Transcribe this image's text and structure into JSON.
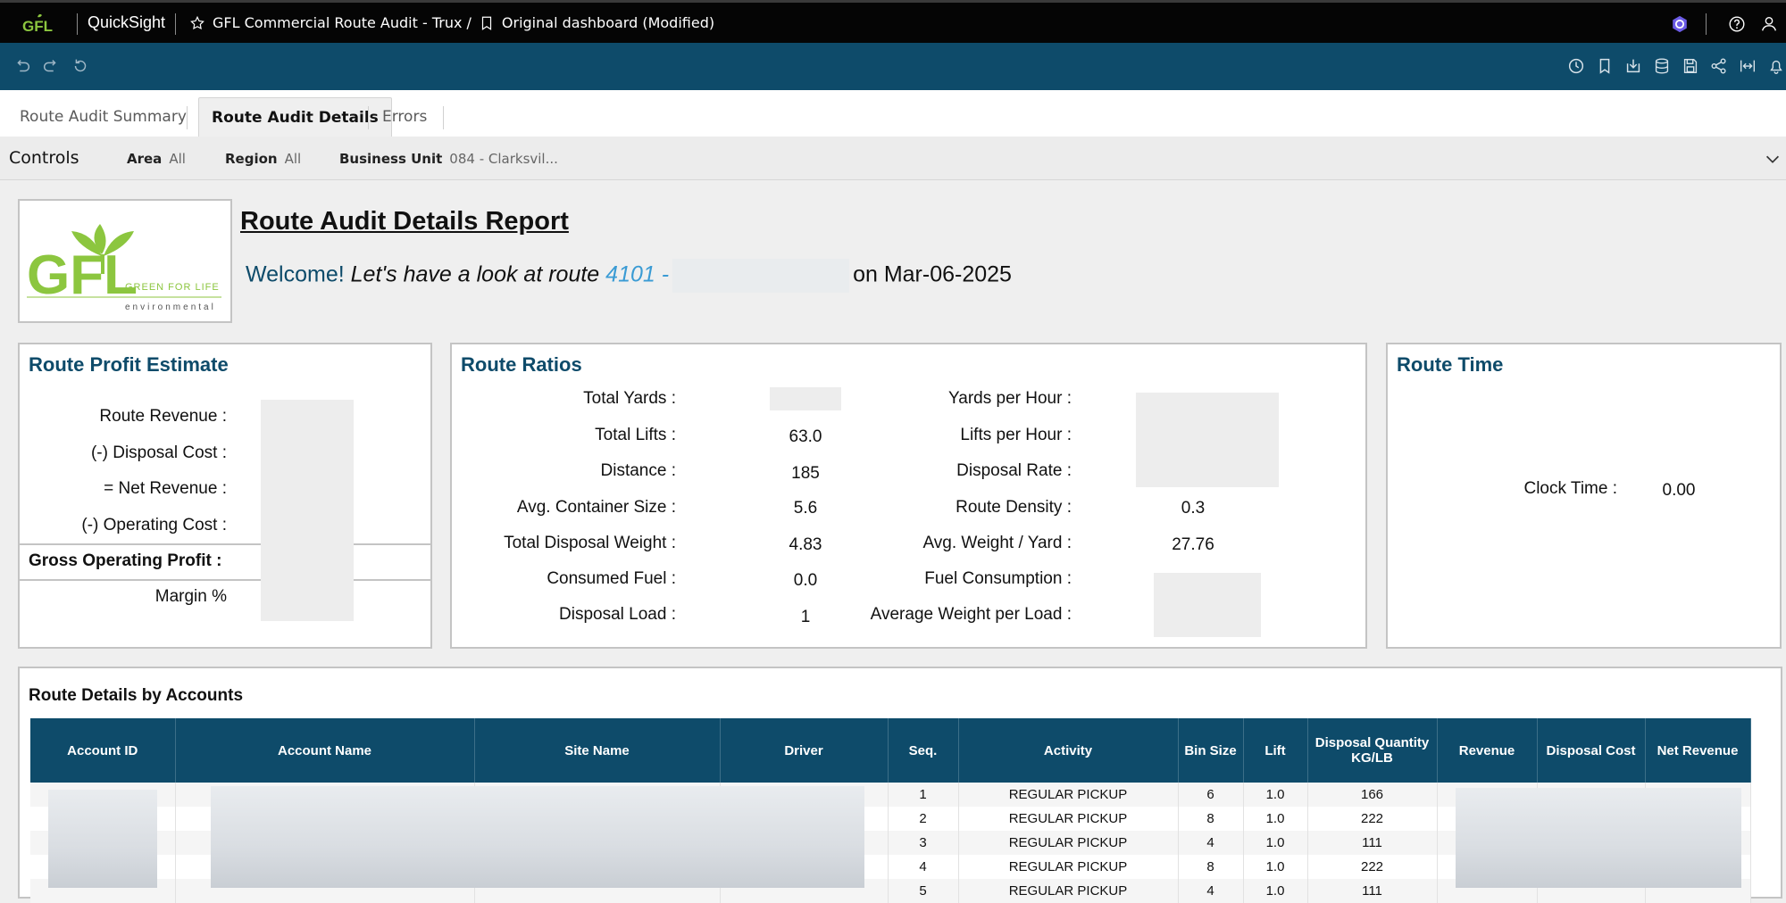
{
  "app": {
    "name": "QuickSight",
    "dashboard_title": "GFL Commercial Route Audit - Trux /",
    "sheet_title": "Original dashboard (Modified)"
  },
  "tabs": [
    {
      "label": "Route Audit Summary"
    },
    {
      "label": "Route Audit Details"
    },
    {
      "label": "Errors"
    }
  ],
  "controls": {
    "label": "Controls",
    "area": {
      "name": "Area",
      "value": "All"
    },
    "region": {
      "name": "Region",
      "value": "All"
    },
    "business_unit": {
      "name": "Business Unit",
      "value": "084 - Clarksvil..."
    }
  },
  "header": {
    "logo_text": "GFL",
    "logo_tagline": "GREEN FOR LIFE",
    "logo_sub": "environmental",
    "title": "Route Audit Details Report ",
    "welcome": "Welcome!",
    "lookat": "Let's have a look at route",
    "route": "4101 -",
    "date": "on Mar-06-2025"
  },
  "profit": {
    "title": "Route Profit Estimate",
    "labels": {
      "revenue": "Route Revenue :",
      "disposal": "(-) Disposal Cost :",
      "net": "= Net Revenue :",
      "operating": "(-) Operating Cost :",
      "gross": "Gross Operating Profit :",
      "margin": "Margin %"
    }
  },
  "ratios": {
    "title": "Route Ratios",
    "left": [
      {
        "label": "Total Yards :",
        "value": ""
      },
      {
        "label": "Total Lifts :",
        "value": "63.0"
      },
      {
        "label": "Distance :",
        "value": "185"
      },
      {
        "label": "Avg. Container Size :",
        "value": "5.6"
      },
      {
        "label": "Total Disposal Weight :",
        "value": "4.83"
      },
      {
        "label": "Consumed Fuel :",
        "value": "0.0"
      },
      {
        "label": "Disposal Load :",
        "value": "1"
      }
    ],
    "right": [
      {
        "label": "Yards per Hour :",
        "value": ""
      },
      {
        "label": "Lifts per Hour :",
        "value": ""
      },
      {
        "label": "Disposal Rate :",
        "value": ""
      },
      {
        "label": "Route Density :",
        "value": "0.3"
      },
      {
        "label": "Avg. Weight / Yard  :",
        "value": "27.76"
      },
      {
        "label": "Fuel Consumption :",
        "value": ""
      },
      {
        "label": "Average Weight per Load :",
        "value": ""
      }
    ]
  },
  "time": {
    "title": "Route Time",
    "clock_label": "Clock Time :",
    "clock_value": "0.00"
  },
  "table": {
    "title": "Route Details by Accounts",
    "columns": [
      "Account ID",
      "Account Name",
      "Site Name",
      "Driver",
      "Seq.",
      "Activity",
      "Bin Size",
      "Lift",
      "Disposal Quantity  KG/LB",
      "Revenue",
      "Disposal Cost",
      "Net Revenue"
    ],
    "rows": [
      {
        "seq": "1",
        "activity": "REGULAR PICKUP",
        "bin": "6",
        "lift": "1.0",
        "qty": "166"
      },
      {
        "seq": "2",
        "activity": "REGULAR PICKUP",
        "bin": "8",
        "lift": "1.0",
        "qty": "222"
      },
      {
        "seq": "3",
        "activity": "REGULAR PICKUP",
        "bin": "4",
        "lift": "1.0",
        "qty": "111"
      },
      {
        "seq": "4",
        "activity": "REGULAR PICKUP",
        "bin": "8",
        "lift": "1.0",
        "qty": "222"
      },
      {
        "seq": "5",
        "activity": "REGULAR PICKUP",
        "bin": "4",
        "lift": "1.0",
        "qty": "111"
      }
    ]
  },
  "colors": {
    "brand_navy": "#0e4b6a",
    "gfl_green": "#8cc63f",
    "link_blue": "#3a9bd4",
    "topbar": "#050505"
  }
}
